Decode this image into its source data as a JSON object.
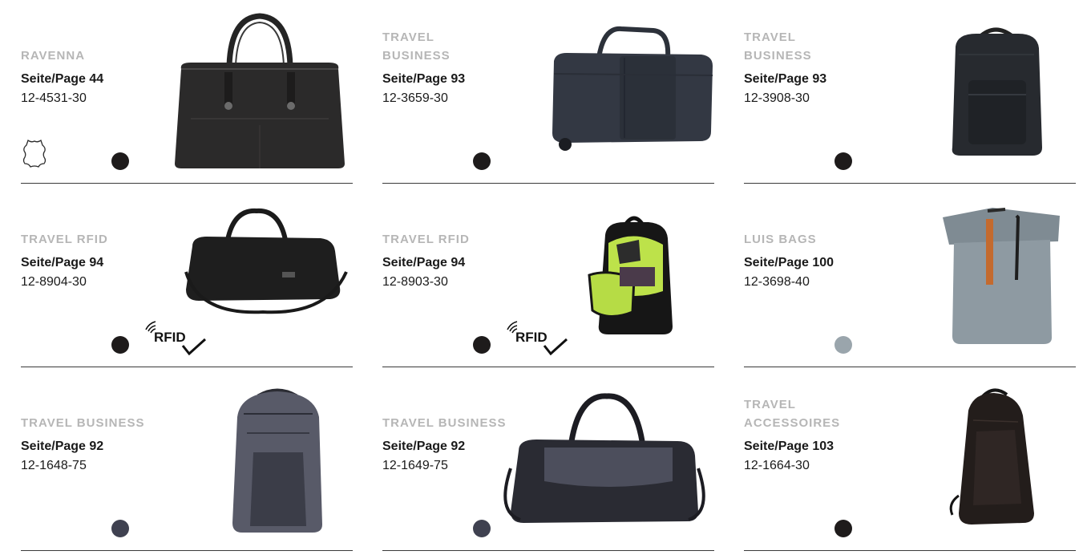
{
  "products": [
    {
      "brand": "RAVENNA",
      "page": "Seite/Page 44",
      "sku": "12-4531-30",
      "color": "#1e1b1b",
      "icon": "leather-icon"
    },
    {
      "brand": "TRAVEL\nBUSINESS",
      "page": "Seite/Page 93",
      "sku": "12-3659-30",
      "color": "#1e1b1b"
    },
    {
      "brand": "TRAVEL\nBUSINESS",
      "page": "Seite/Page 93",
      "sku": "12-3908-30",
      "color": "#1e1b1b"
    },
    {
      "brand": "TRAVEL RFID",
      "page": "Seite/Page 94",
      "sku": "12-8904-30",
      "color": "#1e1b1b",
      "badge": "RFID"
    },
    {
      "brand": "TRAVEL RFID",
      "page": "Seite/Page 94",
      "sku": "12-8903-30",
      "color": "#1e1b1b",
      "badge": "RFID"
    },
    {
      "brand": "LUIS BAGS",
      "page": "Seite/Page 100",
      "sku": "12-3698-40",
      "color": "#9aa5ac"
    },
    {
      "brand": "TRAVEL BUSINESS",
      "page": "Seite/Page 92",
      "sku": "12-1648-75",
      "color": "#3f4150"
    },
    {
      "brand": "TRAVEL BUSINESS",
      "page": "Seite/Page 92",
      "sku": "12-1649-75",
      "color": "#3f4150"
    },
    {
      "brand": "TRAVEL\nACCESSOIRES",
      "page": "Seite/Page 103",
      "sku": "12-1664-30",
      "color": "#1e1b1b"
    }
  ]
}
